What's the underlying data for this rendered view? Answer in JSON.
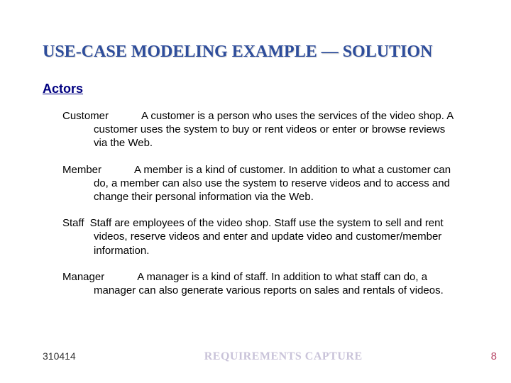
{
  "title": "USE-CASE MODELING EXAMPLE — SOLUTION",
  "section_heading": "Actors",
  "actors": [
    {
      "name": "Customer",
      "gap": "wide",
      "desc": "A customer is a person who uses the services of the video shop. A customer uses the system to buy or rent videos or enter or browse reviews via the Web."
    },
    {
      "name": "Member",
      "gap": "wide",
      "desc": "A member is a kind of customer. In addition to what a customer can do, a member can also use the system to reserve videos and to access and change their personal information via the Web."
    },
    {
      "name": "Staff",
      "gap": "narrow",
      "desc": "Staff are employees of the video shop. Staff use the system to sell and rent videos, reserve videos and enter and update video and customer/member information."
    },
    {
      "name": "Manager",
      "gap": "wide",
      "desc": "A manager is a kind of staff. In addition to what staff can do, a manager can also generate various reports on sales and rentals of videos."
    }
  ],
  "footer": {
    "left": "310414",
    "center": "REQUIREMENTS CAPTURE",
    "right": "8"
  }
}
